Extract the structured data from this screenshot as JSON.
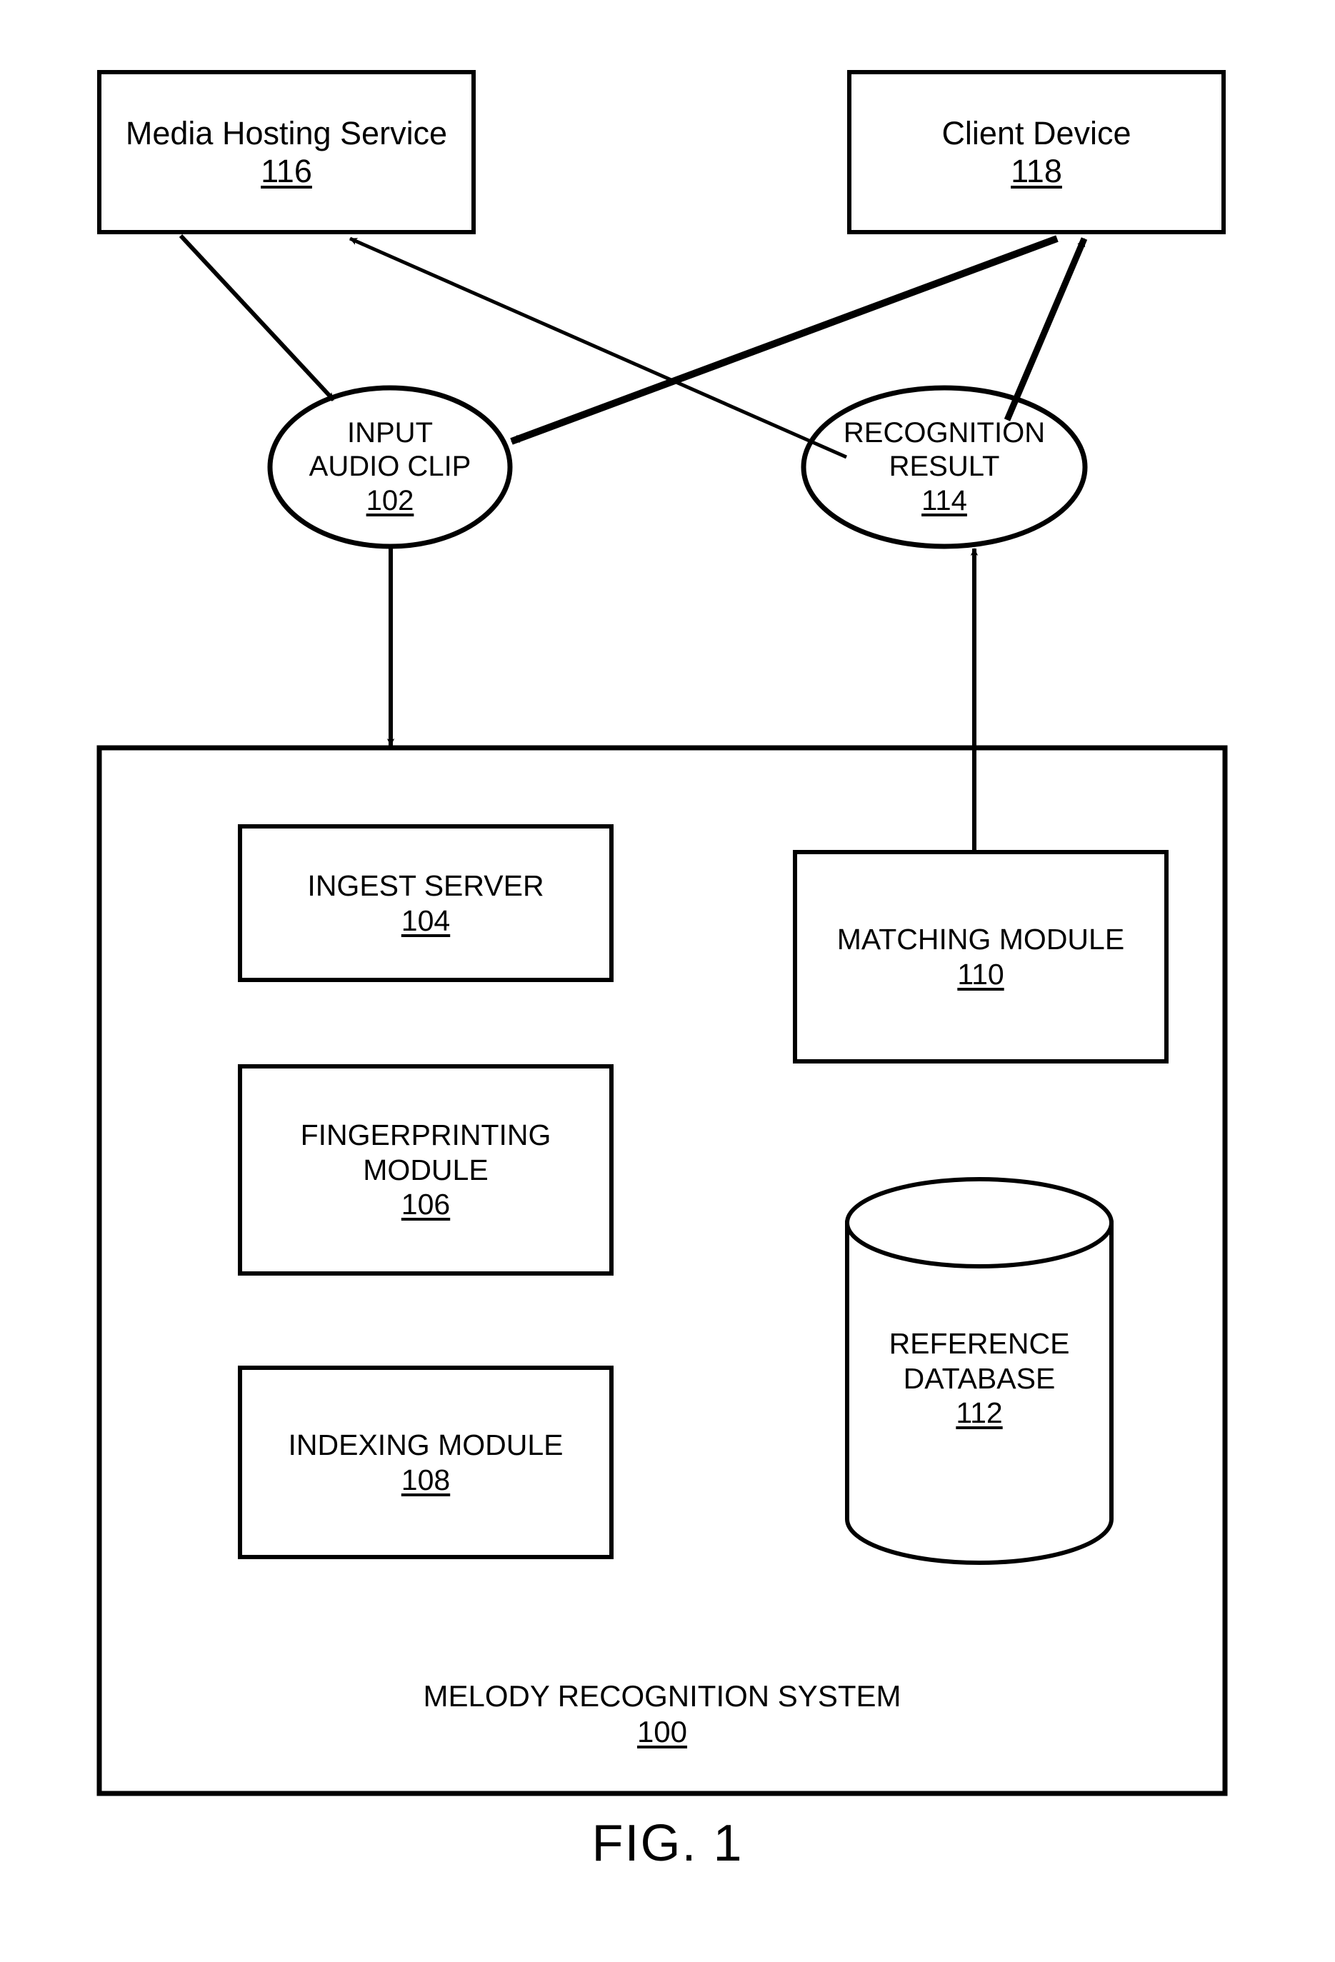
{
  "figure": {
    "caption": "FIG. 1"
  },
  "nodes": {
    "media_hosting_service": {
      "title": "Media Hosting Service",
      "ref": "116",
      "shape": "rectangle"
    },
    "client_device": {
      "title": "Client Device",
      "ref": "118",
      "shape": "rectangle"
    },
    "input_audio_clip": {
      "line1": "INPUT",
      "line2": "AUDIO CLIP",
      "ref": "102",
      "shape": "ellipse"
    },
    "recognition_result": {
      "line1": "RECOGNITION",
      "line2": "RESULT",
      "ref": "114",
      "shape": "ellipse"
    },
    "ingest_server": {
      "line1": "INGEST SERVER",
      "ref": "104",
      "shape": "rectangle"
    },
    "fingerprinting_module": {
      "line1": "FINGERPRINTING",
      "line2": "MODULE",
      "ref": "106",
      "shape": "rectangle"
    },
    "indexing_module": {
      "line1": "INDEXING MODULE",
      "ref": "108",
      "shape": "rectangle"
    },
    "matching_module": {
      "line1": "MATCHING MODULE",
      "ref": "110",
      "shape": "rectangle"
    },
    "reference_database": {
      "line1": "REFERENCE",
      "line2": "DATABASE",
      "ref": "112",
      "shape": "cylinder"
    },
    "melody_recognition_system": {
      "line1": "MELODY RECOGNITION SYSTEM",
      "ref": "100",
      "shape": "container-rectangle"
    }
  },
  "connections": [
    {
      "id": "mhs-to-input",
      "from": "media_hosting_service",
      "to": "input_audio_clip",
      "style": "thin-arrow"
    },
    {
      "id": "recresult-to-mhs",
      "from": "recognition_result",
      "to": "media_hosting_service",
      "style": "thin-arrow"
    },
    {
      "id": "client-to-input",
      "from": "client_device",
      "to": "input_audio_clip",
      "style": "thick-arrow"
    },
    {
      "id": "recresult-to-client",
      "from": "recognition_result",
      "to": "client_device",
      "style": "thick-arrow"
    },
    {
      "id": "input-to-system",
      "from": "input_audio_clip",
      "to": "melody_recognition_system",
      "style": "thin-arrow"
    },
    {
      "id": "matching-to-recresult",
      "from": "matching_module",
      "to": "recognition_result",
      "style": "thin-arrow"
    }
  ],
  "colors": {
    "stroke": "#000000",
    "background": "#ffffff",
    "text": "#000000"
  }
}
